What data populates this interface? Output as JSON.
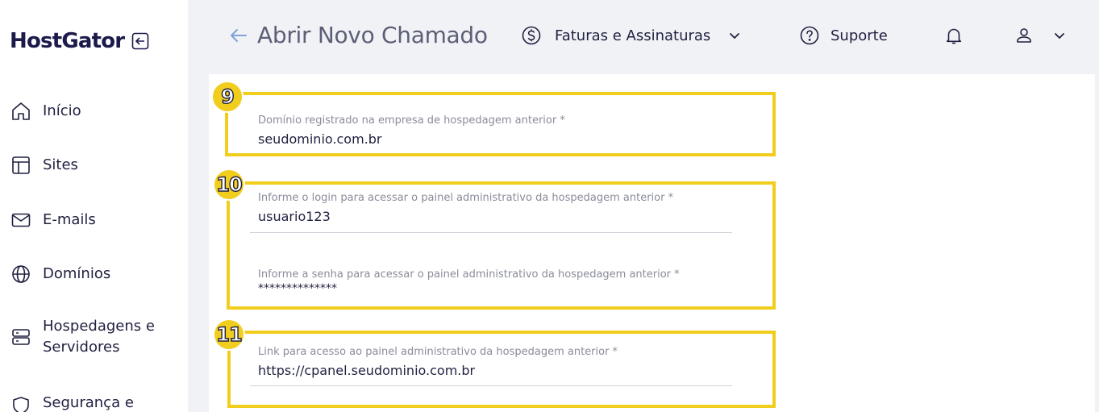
{
  "sidebar": {
    "logo": "HostGator",
    "items": [
      {
        "label": "Início",
        "icon": "home-icon"
      },
      {
        "label": "Sites",
        "icon": "layout-icon"
      },
      {
        "label": "E-mails",
        "icon": "mail-icon"
      },
      {
        "label": "Domínios",
        "icon": "globe-icon"
      },
      {
        "label": "Hospedagens e",
        "label2": "Servidores",
        "icon": "server-icon"
      },
      {
        "label": "Segurança e",
        "icon": "shield-icon"
      }
    ]
  },
  "header": {
    "title": "Abrir Novo Chamado",
    "billing": "Faturas e Assinaturas",
    "support": "Suporte"
  },
  "form": {
    "steps": [
      {
        "number": "9",
        "fields": [
          {
            "label": "Domínio registrado na empresa de hospedagem anterior *",
            "value": "seudominio.com.br"
          }
        ]
      },
      {
        "number": "10",
        "fields": [
          {
            "label": "Informe o login para acessar o painel administrativo da hospedagem anterior *",
            "value": "usuario123"
          },
          {
            "label": "Informe a senha para acessar o painel administrativo da hospedagem anterior *",
            "value": "**************"
          }
        ]
      },
      {
        "number": "11",
        "fields": [
          {
            "label": "Link para acesso ao painel administrativo da hospedagem anterior *",
            "value": "https://cpanel.seudominio.com.br"
          }
        ]
      }
    ]
  },
  "colors": {
    "highlight": "#f1cd1e",
    "brand": "#1b1a4b",
    "text": "#1f2040"
  }
}
